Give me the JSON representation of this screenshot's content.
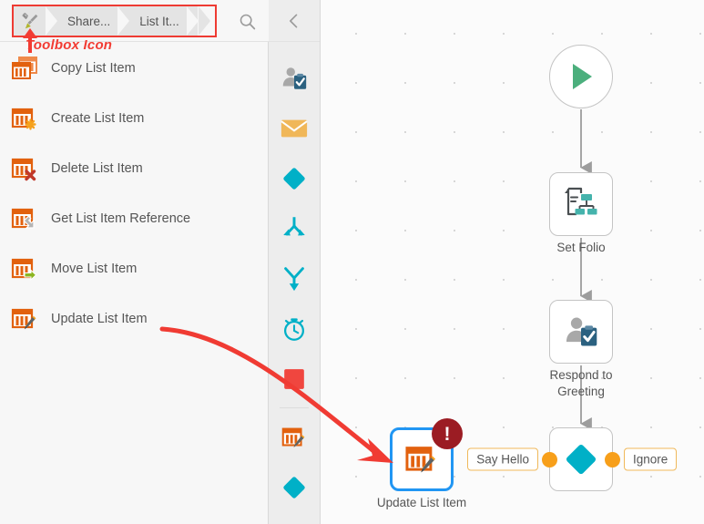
{
  "breadcrumb": {
    "toolbox_icon": "toolbox-icon",
    "items": [
      {
        "label": "",
        "icon": "toolbox-icon"
      },
      {
        "label": "Share..."
      },
      {
        "label": "List It..."
      }
    ]
  },
  "search": {
    "icon": "search-icon",
    "label": "Search"
  },
  "annotation": {
    "text": "Toolbox Icon",
    "color": "#f23c33"
  },
  "collapse": {
    "icon": "chevron-left-icon"
  },
  "toolbox_items": [
    {
      "label": "Copy List Item",
      "icon": "copy-list-item-icon",
      "badge": "copy"
    },
    {
      "label": "Create List Item",
      "icon": "create-list-item-icon",
      "badge": "starburst"
    },
    {
      "label": "Delete List Item",
      "icon": "delete-list-item-icon",
      "badge": "x-mark"
    },
    {
      "label": "Get List Item Reference",
      "icon": "get-list-item-reference-icon",
      "badge": "arrow-curve"
    },
    {
      "label": "Move List Item",
      "icon": "move-list-item-icon",
      "badge": "arrow-right"
    },
    {
      "label": "Update List Item",
      "icon": "update-list-item-icon",
      "badge": "pencil"
    }
  ],
  "icon_strip": [
    {
      "name": "respond-to-greeting-icon",
      "title": "Respond to Greeting"
    },
    {
      "name": "send-email-icon",
      "title": "Send Email"
    },
    {
      "name": "decision-icon",
      "title": "Decision"
    },
    {
      "name": "split-icon",
      "title": "Split"
    },
    {
      "name": "merge-icon",
      "title": "Merge"
    },
    {
      "name": "timer-icon",
      "title": "Timer"
    },
    {
      "name": "stop-icon",
      "title": "Stop"
    },
    {
      "name": "update-list-item-icon",
      "title": "Update List Item"
    },
    {
      "name": "diamond-icon",
      "title": "Diamond"
    }
  ],
  "workflow": {
    "nodes": [
      {
        "id": "start",
        "label": "",
        "icon": "play-icon",
        "shape": "circle"
      },
      {
        "id": "set-folio",
        "label": "Set Folio",
        "icon": "set-folio-icon",
        "shape": "box"
      },
      {
        "id": "respond-to-greeting",
        "label": "Respond to Greeting",
        "icon": "respond-to-greeting-icon",
        "shape": "box"
      },
      {
        "id": "decision",
        "label": "",
        "icon": "decision-diamond-icon",
        "shape": "box"
      },
      {
        "id": "update-list-item",
        "label": "Update List Item",
        "icon": "update-list-item-icon",
        "shape": "box",
        "selected": true,
        "error": true
      }
    ],
    "branches": [
      {
        "label": "Say Hello",
        "side": "left"
      },
      {
        "label": "Ignore",
        "side": "right"
      }
    ],
    "error_badge": "!"
  },
  "colors": {
    "orange": "#e2610e",
    "cyan": "#00b0c7",
    "green": "#4caf7d",
    "red_anno": "#f23c33",
    "select_blue": "#2196f3",
    "error_red": "#9b1c23",
    "port_orange": "#f79f1a"
  }
}
